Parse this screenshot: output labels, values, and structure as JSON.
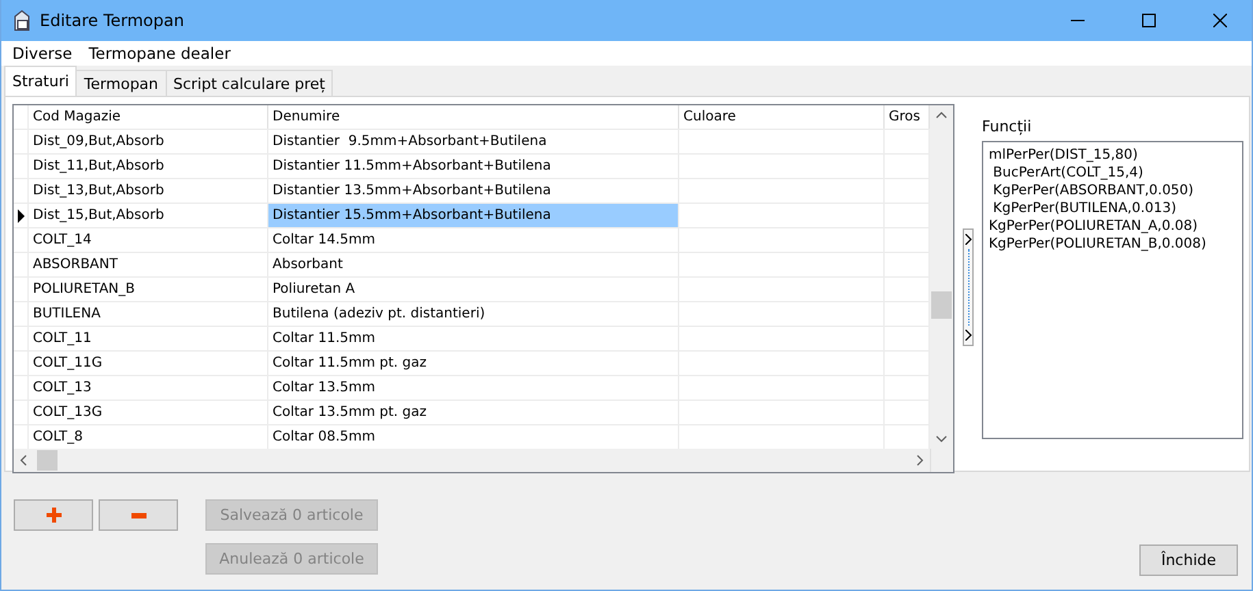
{
  "window": {
    "title": "Editare Termopan"
  },
  "menu": [
    "Diverse",
    "Termopane dealer"
  ],
  "tabs": [
    {
      "label": "Straturi",
      "selected": true
    },
    {
      "label": "Termopan",
      "selected": false
    },
    {
      "label": "Script calculare preț",
      "selected": false
    }
  ],
  "table": {
    "columns": [
      "Cod Magazie",
      "Denumire",
      "Culoare",
      "Gros"
    ],
    "rows": [
      {
        "cells": [
          "Dist_09,But,Absorb",
          "Distantier  9.5mm+Absorbant+Butilena"
        ],
        "selected": false
      },
      {
        "cells": [
          "Dist_11,But,Absorb",
          "Distantier 11.5mm+Absorbant+Butilena"
        ],
        "selected": false
      },
      {
        "cells": [
          "Dist_13,But,Absorb",
          "Distantier 13.5mm+Absorbant+Butilena"
        ],
        "selected": false
      },
      {
        "cells": [
          "Dist_15,But,Absorb",
          "Distantier 15.5mm+Absorbant+Butilena"
        ],
        "selected": true
      },
      {
        "cells": [
          "COLT_14",
          "Coltar 14.5mm"
        ],
        "selected": false
      },
      {
        "cells": [
          "ABSORBANT",
          "Absorbant"
        ],
        "selected": false
      },
      {
        "cells": [
          "POLIURETAN_B",
          "Poliuretan A"
        ],
        "selected": false
      },
      {
        "cells": [
          "BUTILENA",
          "Butilena (adeziv pt. distantieri)"
        ],
        "selected": false
      },
      {
        "cells": [
          "COLT_11",
          "Coltar 11.5mm"
        ],
        "selected": false
      },
      {
        "cells": [
          "COLT_11G",
          "Coltar 11.5mm pt. gaz"
        ],
        "selected": false
      },
      {
        "cells": [
          "COLT_13",
          "Coltar 13.5mm"
        ],
        "selected": false
      },
      {
        "cells": [
          "COLT_13G",
          "Coltar 13.5mm pt. gaz"
        ],
        "selected": false
      },
      {
        "cells": [
          "COLT_8",
          "Coltar 08.5mm"
        ],
        "selected": false
      }
    ]
  },
  "functions": {
    "label": "Funcții",
    "lines": [
      "mlPerPer(DIST_15,80)",
      " BucPerArt(COLT_15,4)",
      " KgPerPer(ABSORBANT,0.050)",
      " KgPerPer(BUTILENA,0.013)",
      "KgPerPer(POLIURETAN_A,0.08)",
      "KgPerPer(POLIURETAN_B,0.008)"
    ]
  },
  "buttons": [
    {
      "kind": "add",
      "disabled": false
    },
    {
      "kind": "remove",
      "disabled": false
    },
    {
      "kind": "text",
      "label": "Salvează 0 articole",
      "disabled": true
    },
    {
      "kind": "text",
      "label": "Anulează 0 articole",
      "disabled": true
    },
    {
      "kind": "text",
      "label": "Închide",
      "disabled": false
    }
  ]
}
